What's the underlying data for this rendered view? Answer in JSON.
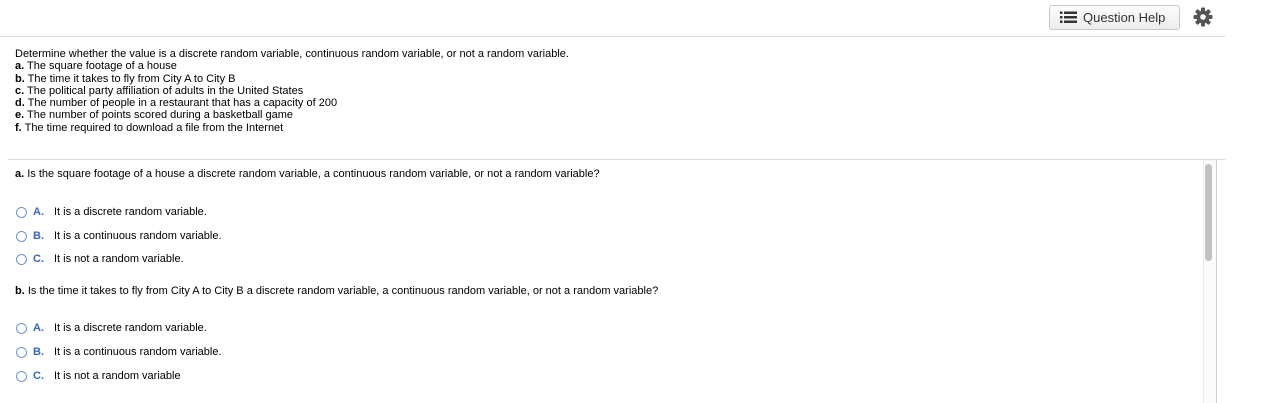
{
  "toolbar": {
    "question_help_label": "Question Help",
    "question_help_icon": "list-icon",
    "settings_icon": "gear-icon"
  },
  "intro": {
    "instruction": "Determine whether the value is a discrete random variable, continuous random variable, or not a random variable.",
    "items": [
      {
        "letter": "a.",
        "text": "The square footage of a house"
      },
      {
        "letter": "b.",
        "text": "The time it takes to fly from City A to City B"
      },
      {
        "letter": "c.",
        "text": "The political party affiliation of adults in the United States"
      },
      {
        "letter": "d.",
        "text": "The number of people in a restaurant that has a capacity of 200"
      },
      {
        "letter": "e.",
        "text": "The number of points scored during a basketball game"
      },
      {
        "letter": "f.",
        "text": "The time required to download a file from the Internet"
      }
    ]
  },
  "questions": [
    {
      "letter": "a.",
      "prompt": "Is the square footage of a house a discrete random variable, a continuous random variable, or not a random variable?",
      "options": [
        {
          "letter": "A.",
          "text": "It is a discrete random variable."
        },
        {
          "letter": "B.",
          "text": "It is a continuous random variable."
        },
        {
          "letter": "C.",
          "text": "It is not a random variable."
        }
      ]
    },
    {
      "letter": "b.",
      "prompt": "Is the time it takes to fly from City A to City B a discrete random variable, a continuous random variable, or not a random variable?",
      "options": [
        {
          "letter": "A.",
          "text": "It is a discrete random variable."
        },
        {
          "letter": "B.",
          "text": "It is a continuous random variable."
        },
        {
          "letter": "C.",
          "text": "It is not a random variable"
        }
      ]
    }
  ],
  "colors": {
    "option_letter": "#3b67b0",
    "radio_border": "#6f96c9"
  }
}
